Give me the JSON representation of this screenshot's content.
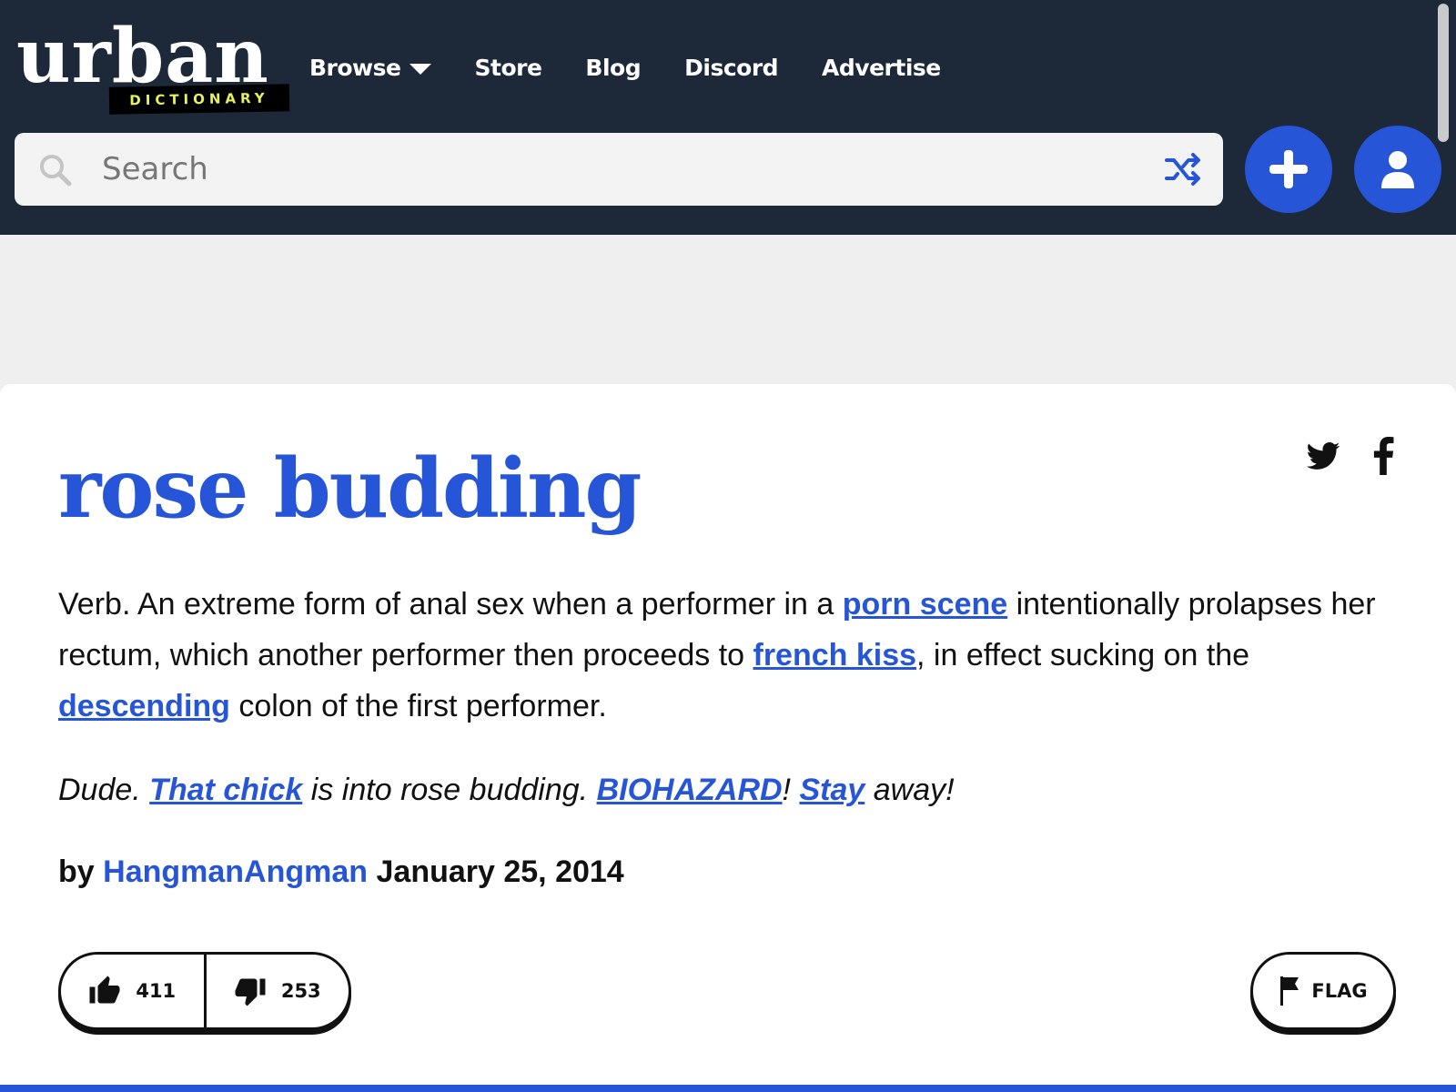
{
  "logo": {
    "word": "urban",
    "tagline": "DICTIONARY"
  },
  "nav": {
    "items": [
      {
        "label": "Browse"
      },
      {
        "label": "Store"
      },
      {
        "label": "Blog"
      },
      {
        "label": "Discord"
      },
      {
        "label": "Advertise"
      }
    ]
  },
  "search": {
    "placeholder": "Search",
    "value": ""
  },
  "icons": {
    "search": "search-icon",
    "random": "shuffle-icon",
    "add": "plus-icon",
    "account": "user-icon",
    "twitter": "twitter-icon",
    "facebook": "facebook-icon",
    "upvote": "thumbs-up-icon",
    "downvote": "thumbs-down-icon",
    "flag": "flag-icon"
  },
  "colors": {
    "header_bg": "#1d2838",
    "accent": "#2655d8",
    "logo_tag": "#e6f25a",
    "page_bg": "#efefef",
    "card_bg": "#ffffff"
  },
  "entry": {
    "term": "rose budding",
    "definition": {
      "t1": "Verb. An extreme form of anal sex when a performer in a ",
      "l1": "porn scene",
      "t2": " intentionally prolapses her rectum, which another performer then proceeds to ",
      "l2": "french kiss",
      "t3": ", in effect sucking on the ",
      "l3": "descending",
      "t4": " colon of the first performer."
    },
    "example": {
      "t1": "Dude. ",
      "l1": "That chick",
      "t2": " is into rose budding. ",
      "l2": "BIOHAZARD",
      "t3": "! ",
      "l3": "Stay",
      "t4": " away!"
    },
    "by_label": "by",
    "author": "HangmanAngman",
    "date": "January 25, 2014",
    "upvotes": "411",
    "downvotes": "253",
    "flag_label": "FLAG"
  }
}
